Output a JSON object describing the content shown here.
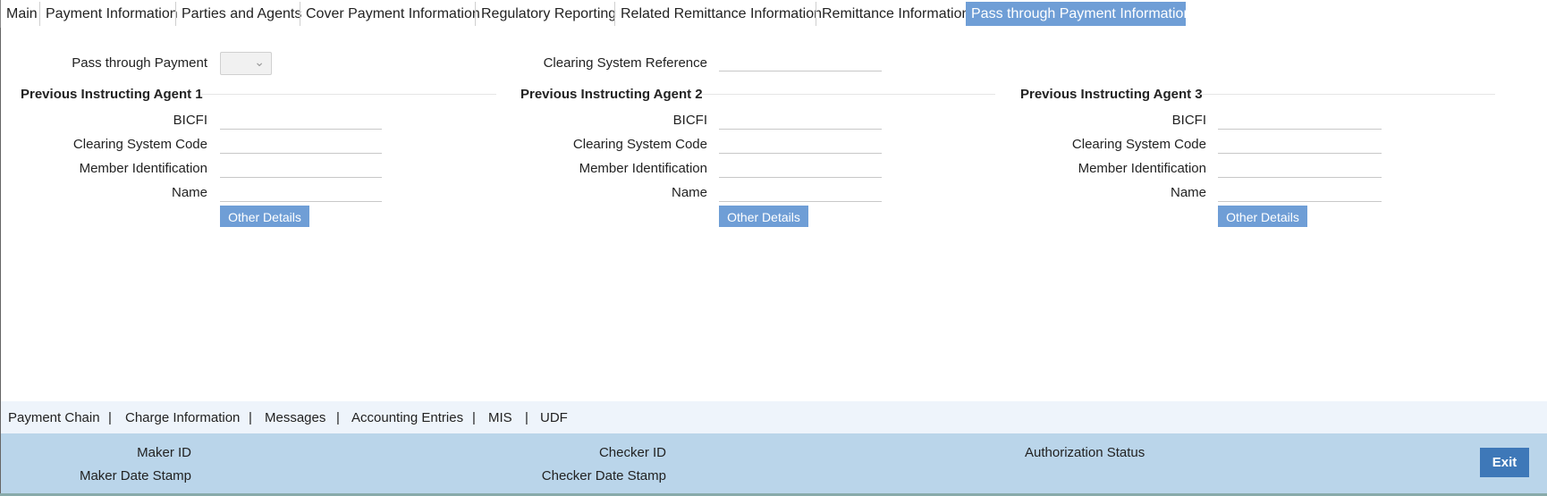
{
  "tabs": [
    {
      "label": "Main"
    },
    {
      "label": "Payment Information"
    },
    {
      "label": "Parties and Agents"
    },
    {
      "label": "Cover Payment Information"
    },
    {
      "label": "Regulatory Reporting"
    },
    {
      "label": "Related Remittance Information"
    },
    {
      "label": "Remittance Information"
    },
    {
      "label": "Pass through Payment Information"
    }
  ],
  "form": {
    "pass_through_payment_label": "Pass through Payment",
    "pass_through_payment_value": "",
    "clearing_system_reference_label": "Clearing System Reference",
    "clearing_system_reference_value": ""
  },
  "agents": [
    {
      "title": "Previous Instructing Agent 1",
      "bicfi_label": "BICFI",
      "clearing_system_code_label": "Clearing System Code",
      "member_identification_label": "Member Identification",
      "name_label": "Name",
      "other_details_label": "Other Details"
    },
    {
      "title": "Previous Instructing Agent 2",
      "bicfi_label": "BICFI",
      "clearing_system_code_label": "Clearing System Code",
      "member_identification_label": "Member Identification",
      "name_label": "Name",
      "other_details_label": "Other Details"
    },
    {
      "title": "Previous Instructing Agent 3",
      "bicfi_label": "BICFI",
      "clearing_system_code_label": "Clearing System Code",
      "member_identification_label": "Member Identification",
      "name_label": "Name",
      "other_details_label": "Other Details"
    }
  ],
  "bottom_links": [
    {
      "label": "Payment Chain"
    },
    {
      "label": "Charge Information"
    },
    {
      "label": "Messages"
    },
    {
      "label": "Accounting Entries"
    },
    {
      "label": "MIS"
    },
    {
      "label": "UDF"
    }
  ],
  "link_separator": "|",
  "footer": {
    "maker_id_label": "Maker ID",
    "maker_date_stamp_label": "Maker Date Stamp",
    "checker_id_label": "Checker ID",
    "checker_date_stamp_label": "Checker Date Stamp",
    "authorization_status_label": "Authorization Status",
    "exit_label": "Exit"
  },
  "colors": {
    "active_tab": "#6f9ed6",
    "button": "#6f9ed6",
    "footer": "#bad5ea",
    "links_bar": "#eef4fb",
    "exit_button": "#3e78b8"
  }
}
